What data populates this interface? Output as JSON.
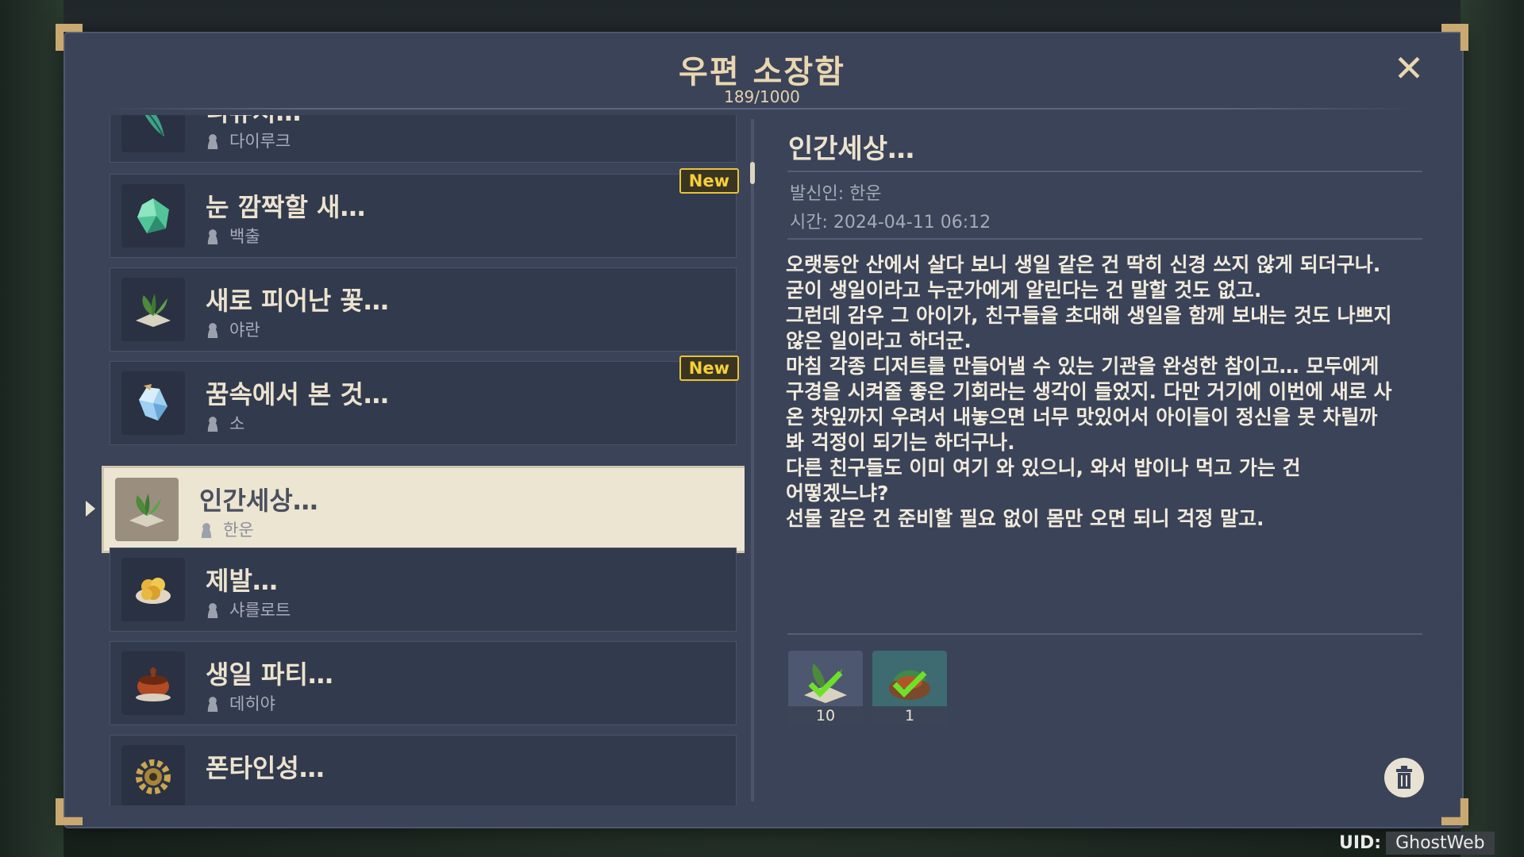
{
  "window": {
    "title": "우편 소장함",
    "count": "189/1000"
  },
  "mail_list": [
    {
      "title": "니퓨처…",
      "sender": "다이루크",
      "new": "",
      "icon": "leaf-charm-icon",
      "selected": false
    },
    {
      "title": "눈 깜짝할 새…",
      "sender": "백출",
      "new": "New",
      "icon": "green-crystal-icon",
      "selected": false
    },
    {
      "title": "새로 피어난 꽃…",
      "sender": "야란",
      "new": "",
      "icon": "herb-leaves-icon",
      "selected": false
    },
    {
      "title": "꿈속에서 본 것…",
      "sender": "소",
      "new": "New",
      "icon": "blue-crystal-icon",
      "selected": false
    },
    {
      "title": "인간세상…",
      "sender": "한운",
      "new": "",
      "icon": "herb-leaves-icon",
      "selected": true
    },
    {
      "title": "제발…",
      "sender": "샤를로트",
      "new": "",
      "icon": "golden-dish-icon",
      "selected": false
    },
    {
      "title": "생일 파티…",
      "sender": "데히야",
      "new": "",
      "icon": "stew-pot-icon",
      "selected": false
    },
    {
      "title": "폰타인성…",
      "sender": "",
      "new": "",
      "icon": "gear-icon",
      "selected": false
    }
  ],
  "detail": {
    "title": "인간세상…",
    "sender": "발신인: 한운",
    "time": "시간: 2024-04-11 06:12",
    "body": [
      "오랫동안 산에서 살다 보니 생일 같은 건 딱히 신경 쓰지 않게 되더구나.",
      "굳이 생일이라고 누군가에게 알린다는 건 말할 것도 없고.",
      "그런데 감우 그 아이가, 친구들을 초대해 생일을 함께 보내는 것도 나쁘지",
      "않은 일이라고 하더군.",
      "마침 각종 디저트를 만들어낼 수 있는 기관을 완성한 참이고… 모두에게",
      "구경을 시켜줄 좋은 기회라는 생각이 들었지. 다만 거기에 이번에 새로 사",
      "온 찻잎까지 우려서 내놓으면 너무 맛있어서 아이들이 정신을 못 차릴까",
      "봐 걱정이 되기는 하더구나.",
      "다른 친구들도 이미 여기 와 있으니, 와서 밥이나 먹고 가는 건",
      "어떻겠느냐?",
      "선물 같은 건 준비할 필요 없이 몸만 오면 되니 걱정 말고."
    ],
    "attachments": [
      {
        "icon": "herb-leaves-claimed-icon",
        "qty": "10"
      },
      {
        "icon": "dish-claimed-icon",
        "qty": "1"
      }
    ]
  },
  "uid": {
    "label": "UID:",
    "value": "GhostWeb"
  },
  "colors": {
    "panel": "#3b4358",
    "accent_gold": "#e8c33a",
    "title_text": "#e9d7b0"
  }
}
